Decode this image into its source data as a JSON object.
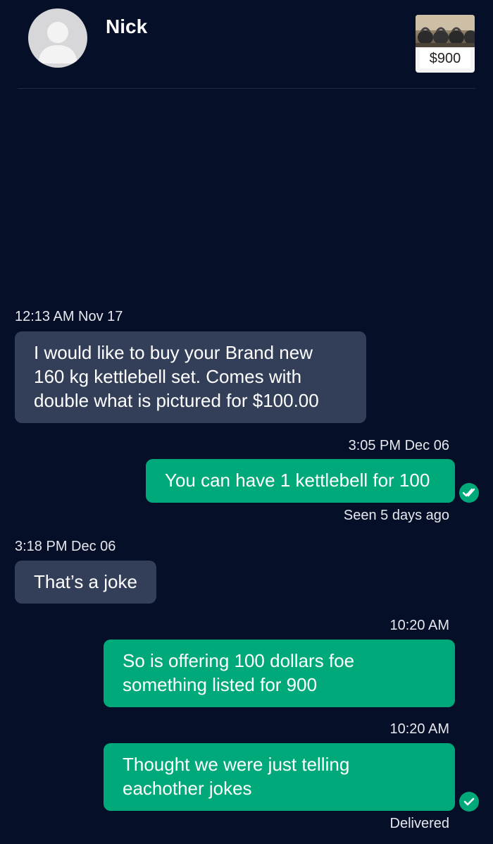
{
  "header": {
    "contact_name": "Nick",
    "listing_price": "$900"
  },
  "messages": [
    {
      "direction": "incoming",
      "timestamp": "12:13 AM Nov 17",
      "lines": [
        "I would like to buy your Brand new",
        "160 kg kettlebell set. Comes with",
        "double what is pictured for $100.00"
      ]
    },
    {
      "direction": "outgoing",
      "timestamp": "3:05 PM Dec 06",
      "lines": [
        "You can have 1 kettlebell for 100"
      ],
      "status": "Seen 5 days ago",
      "status_icon": "double-check-icon"
    },
    {
      "direction": "incoming",
      "timestamp": "3:18 PM Dec 06",
      "lines": [
        "That’s a joke"
      ]
    },
    {
      "direction": "outgoing",
      "timestamp": "10:20 AM",
      "lines": [
        "So is offering 100 dollars foe",
        "something listed for 900"
      ]
    },
    {
      "direction": "outgoing",
      "timestamp": "10:20 AM",
      "lines": [
        "Thought we were just telling",
        "eachother jokes"
      ],
      "status": "Delivered",
      "status_icon": "check-icon"
    }
  ],
  "colors": {
    "background": "#060f28",
    "incoming_bubble": "#333f58",
    "outgoing_bubble": "#00a97a"
  }
}
